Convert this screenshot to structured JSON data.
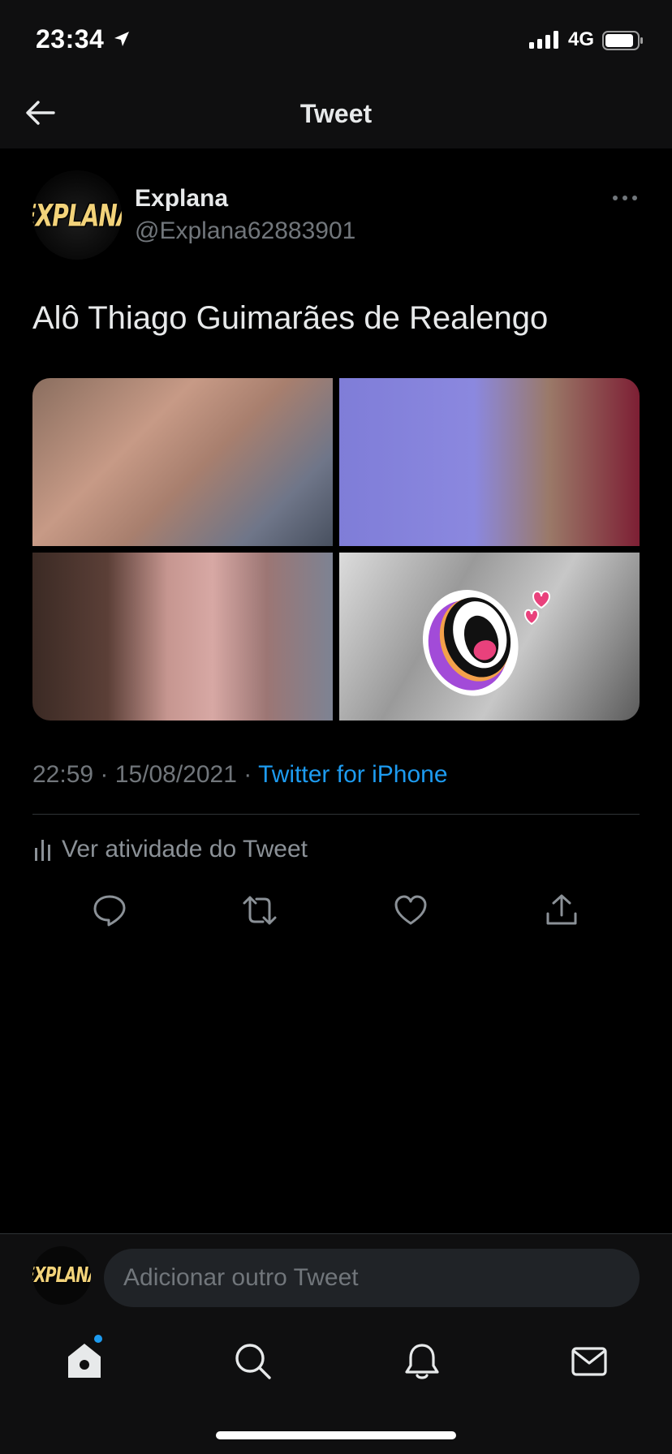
{
  "status_bar": {
    "time": "23:34",
    "network": "4G"
  },
  "header": {
    "title": "Tweet"
  },
  "tweet": {
    "author": {
      "name": "Explana",
      "handle": "@Explana62883901",
      "avatar_text": "EXPLANA"
    },
    "text": "Alô Thiago Guimarães de Realengo",
    "media_count": 4,
    "time": "22:59",
    "date": "15/08/2021",
    "separator": "·",
    "source": "Twitter for iPhone",
    "activity_label": "Ver atividade do Tweet"
  },
  "compose": {
    "placeholder": "Adicionar outro Tweet",
    "avatar_text": "EXPLANA"
  },
  "colors": {
    "background": "#000000",
    "accent": "#1d9bf0",
    "secondary_text": "#71767b",
    "primary_text": "#e7e9ea"
  },
  "icons": {
    "back": "arrow-left-icon",
    "more": "more-horizontal-icon",
    "activity": "bar-chart-icon",
    "reply": "reply-icon",
    "retweet": "retweet-icon",
    "like": "heart-icon",
    "share": "share-icon",
    "home": "home-icon",
    "search": "search-icon",
    "notifications": "bell-icon",
    "messages": "mail-icon"
  }
}
